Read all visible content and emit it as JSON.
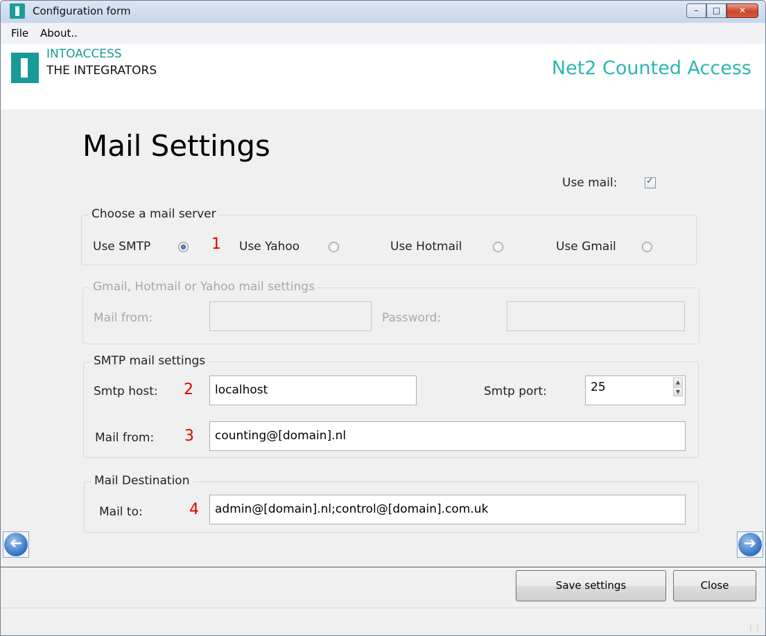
{
  "window": {
    "title": "Configuration form"
  },
  "menu": {
    "file": "File",
    "about": "About.."
  },
  "header": {
    "logo_line1": "INTOACCESS",
    "logo_line2": "THE INTEGRATORS",
    "product": "Net2 Counted Access"
  },
  "page": {
    "title": "Mail Settings"
  },
  "use_mail": {
    "label": "Use mail:",
    "checked": true
  },
  "mail_server": {
    "group_title": "Choose a mail server",
    "options": [
      {
        "label": "Use SMTP",
        "selected": true
      },
      {
        "label": "Use Yahoo",
        "selected": false
      },
      {
        "label": "Use Hotmail",
        "selected": false
      },
      {
        "label": "Use Gmail",
        "selected": false
      }
    ]
  },
  "provider_settings": {
    "group_title": "Gmail, Hotmail or Yahoo mail settings",
    "mail_from_label": "Mail from:",
    "mail_from_value": "",
    "password_label": "Password:",
    "password_value": ""
  },
  "smtp": {
    "group_title": "SMTP mail settings",
    "host_label": "Smtp host:",
    "host_value": "localhost",
    "port_label": "Smtp port:",
    "port_value": "25",
    "mail_from_label": "Mail from:",
    "mail_from_value": "counting@[domain].nl"
  },
  "destination": {
    "group_title": "Mail Destination",
    "mail_to_label": "Mail to:",
    "mail_to_value": "admin@[domain].nl;control@[domain].com.uk"
  },
  "markers": [
    "1",
    "2",
    "3",
    "4"
  ],
  "buttons": {
    "save": "Save settings",
    "close": "Close"
  },
  "colors": {
    "brand": "#1a9a96",
    "product": "#2bb7b0",
    "marker": "#e00000"
  }
}
